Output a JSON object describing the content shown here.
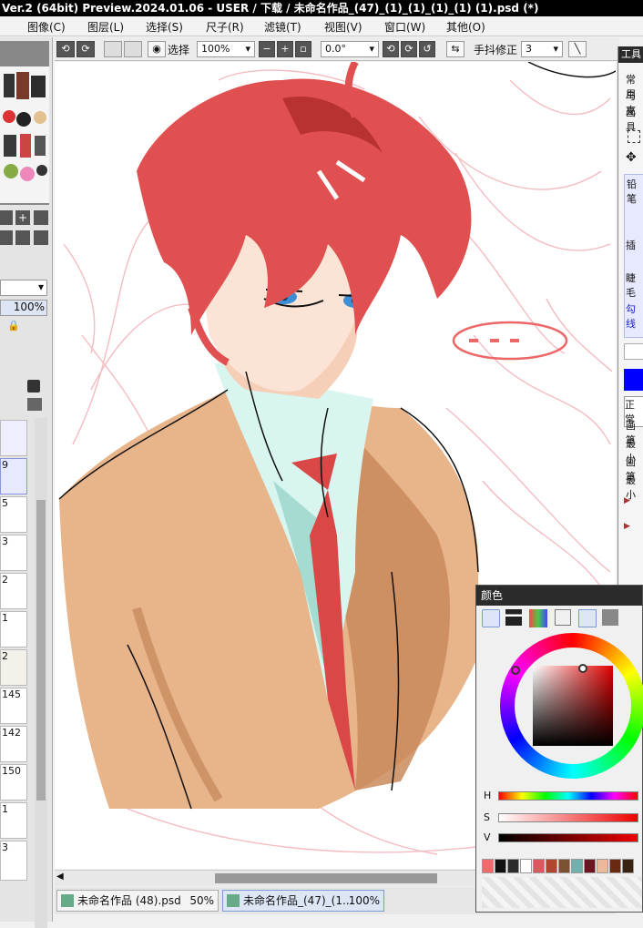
{
  "title": "Ver.2 (64bit) Preview.2024.01.06 - USER / 下载 / 未命名作品_(47)_(1)_(1)_(1)_(1) (1).psd (*)",
  "menu": [
    "图像(C)",
    "图层(L)",
    "选择(S)",
    "尺子(R)",
    "滤镜(T)",
    "视图(V)",
    "窗口(W)",
    "其他(O)"
  ],
  "toolbar": {
    "select_label": "选择",
    "zoom": "100%",
    "rotation": "0.0°",
    "stabilizer_label": "手抖修正",
    "stabilizer_value": "3"
  },
  "left_panel": {
    "opacity": "100%",
    "layers": [
      "9",
      "5",
      "3",
      "2",
      "1",
      "2",
      "145",
      "142",
      "150",
      "1",
      "3"
    ]
  },
  "tool_panel": {
    "title": "工具",
    "items": [
      "常用",
      "马克",
      "画具",
      "铅笔",
      "插",
      "睫毛",
      "勾线",
      "正常",
      "画笔",
      "最小",
      "画笔",
      "最小"
    ]
  },
  "color_panel": {
    "title": "颜色",
    "labels": {
      "h": "H",
      "s": "S",
      "v": "V"
    },
    "palette": [
      "#f06b6b",
      "#111111",
      "#2b2b2b",
      "#ffffff",
      "#d9585e",
      "#b0462f",
      "#7a5230",
      "#6fb2ad",
      "#6c1220",
      "#e9b99a",
      "#6b2a10",
      "#3a2212"
    ]
  },
  "tabs": [
    {
      "name": "未命名作品 (48).psd",
      "zoom": "50%"
    },
    {
      "name": "未命名作品_(47)_(1...",
      "zoom": "100%"
    }
  ],
  "colors": {
    "hair": "#e05050",
    "jacket": "#e8b48a",
    "shirt": "#d9f5ef",
    "tie": "#d94747",
    "foreground": "#0000ff"
  }
}
